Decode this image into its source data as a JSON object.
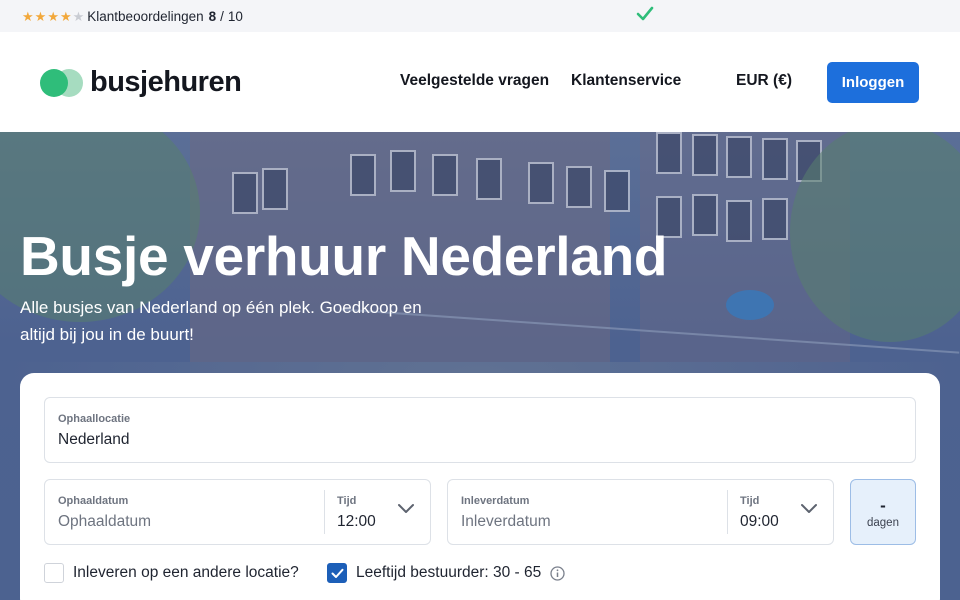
{
  "topbar": {
    "stars": [
      {
        "icon": "star-filled-icon",
        "color": "#f2a83b"
      },
      {
        "icon": "star-filled-icon",
        "color": "#f2a83b"
      },
      {
        "icon": "star-filled-icon",
        "color": "#f2a83b"
      },
      {
        "icon": "star-filled-icon",
        "color": "#f2a83b"
      },
      {
        "icon": "star-empty-icon",
        "color": "#c9ccd3"
      }
    ],
    "rating_label": "Klantbeoordelingen",
    "rating_score": "8",
    "rating_separator": "/",
    "rating_max": "10",
    "usp_icon": "check-icon",
    "usp_color": "#2fbd7a"
  },
  "header": {
    "logo_text": "busjehuren",
    "nav": {
      "faq": "Veelgestelde vragen",
      "service": "Klantenservice",
      "currency": "EUR (€)"
    },
    "login_label": "Inloggen",
    "accent_color": "#1d6fdc"
  },
  "hero": {
    "title": "Busje verhuur Nederland",
    "subtitle": "Alle busjes van Nederland op één plek. Goedkoop en altijd bij jou in de buurt!"
  },
  "booking": {
    "location": {
      "label": "Ophaallocatie",
      "value": "Nederland"
    },
    "pickup": {
      "date_label": "Ophaaldatum",
      "date_placeholder": "Ophaaldatum",
      "time_label": "Tijd",
      "time_value": "12:00"
    },
    "dropoff": {
      "date_label": "Inleverdatum",
      "date_placeholder": "Inleverdatum",
      "time_label": "Tijd",
      "time_value": "09:00"
    },
    "days": {
      "value": "-",
      "label": "dagen"
    },
    "other_location_label": "Inleveren op een andere locatie?",
    "other_location_checked": false,
    "driver_age_label": "Leeftijd bestuurder: 30 - 65",
    "driver_age_checked": true
  }
}
